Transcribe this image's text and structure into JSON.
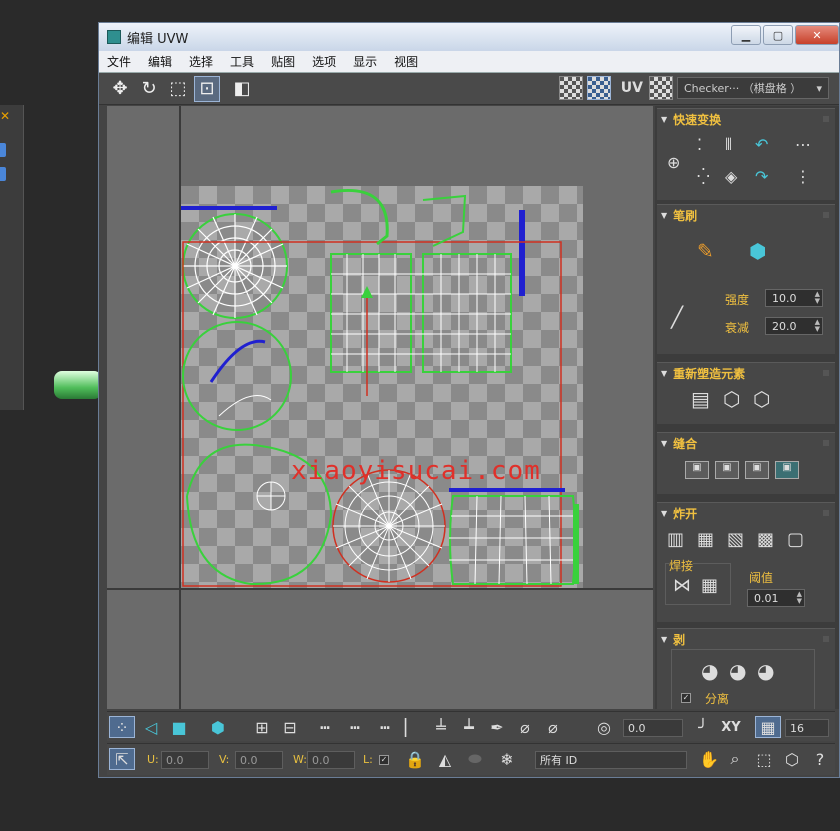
{
  "window": {
    "title": "编辑 UVW",
    "controls": {
      "minimize": "▭",
      "maximize": "▭",
      "close": "✕"
    }
  },
  "menu": [
    "文件",
    "编辑",
    "选择",
    "工具",
    "贴图",
    "选项",
    "显示",
    "视图"
  ],
  "toolbar": {
    "uv_label": "UV",
    "checker_dropdown": "Checker··· （棋盘格 ）"
  },
  "panel": {
    "quick_transform": {
      "title": "快速变换"
    },
    "brush": {
      "title": "笔刷",
      "strength_label": "强度",
      "strength_value": "10.0",
      "falloff_label": "衰减",
      "falloff_value": "20.0"
    },
    "reshape": {
      "title": "重新塑造元素"
    },
    "stitch": {
      "title": "缝合"
    },
    "explode": {
      "title": "炸开",
      "weld_label": "焊接",
      "threshold_label": "阈值",
      "threshold_value": "0.01"
    },
    "peel": {
      "title": "剥",
      "detach_label": "分离"
    }
  },
  "bottom": {
    "angle_value": "0.0",
    "xy_label": "XY",
    "grid_value": "16",
    "u_label": "U:",
    "u_value": "0.0",
    "v_label": "V:",
    "v_value": "0.0",
    "w_label": "W:",
    "w_value": "0.0",
    "l_label": "L:",
    "id_filter": "所有 ID"
  },
  "watermark": "xiaoyisucai.com",
  "colors": {
    "title_gradient_top": "#eef3fa",
    "panel_header": "#f0c040",
    "uv_edge_green": "#39d13c",
    "uv_edge_white": "#ffffff",
    "uv_selection_blue": "#2020d0",
    "seam_red": "#d03020"
  }
}
